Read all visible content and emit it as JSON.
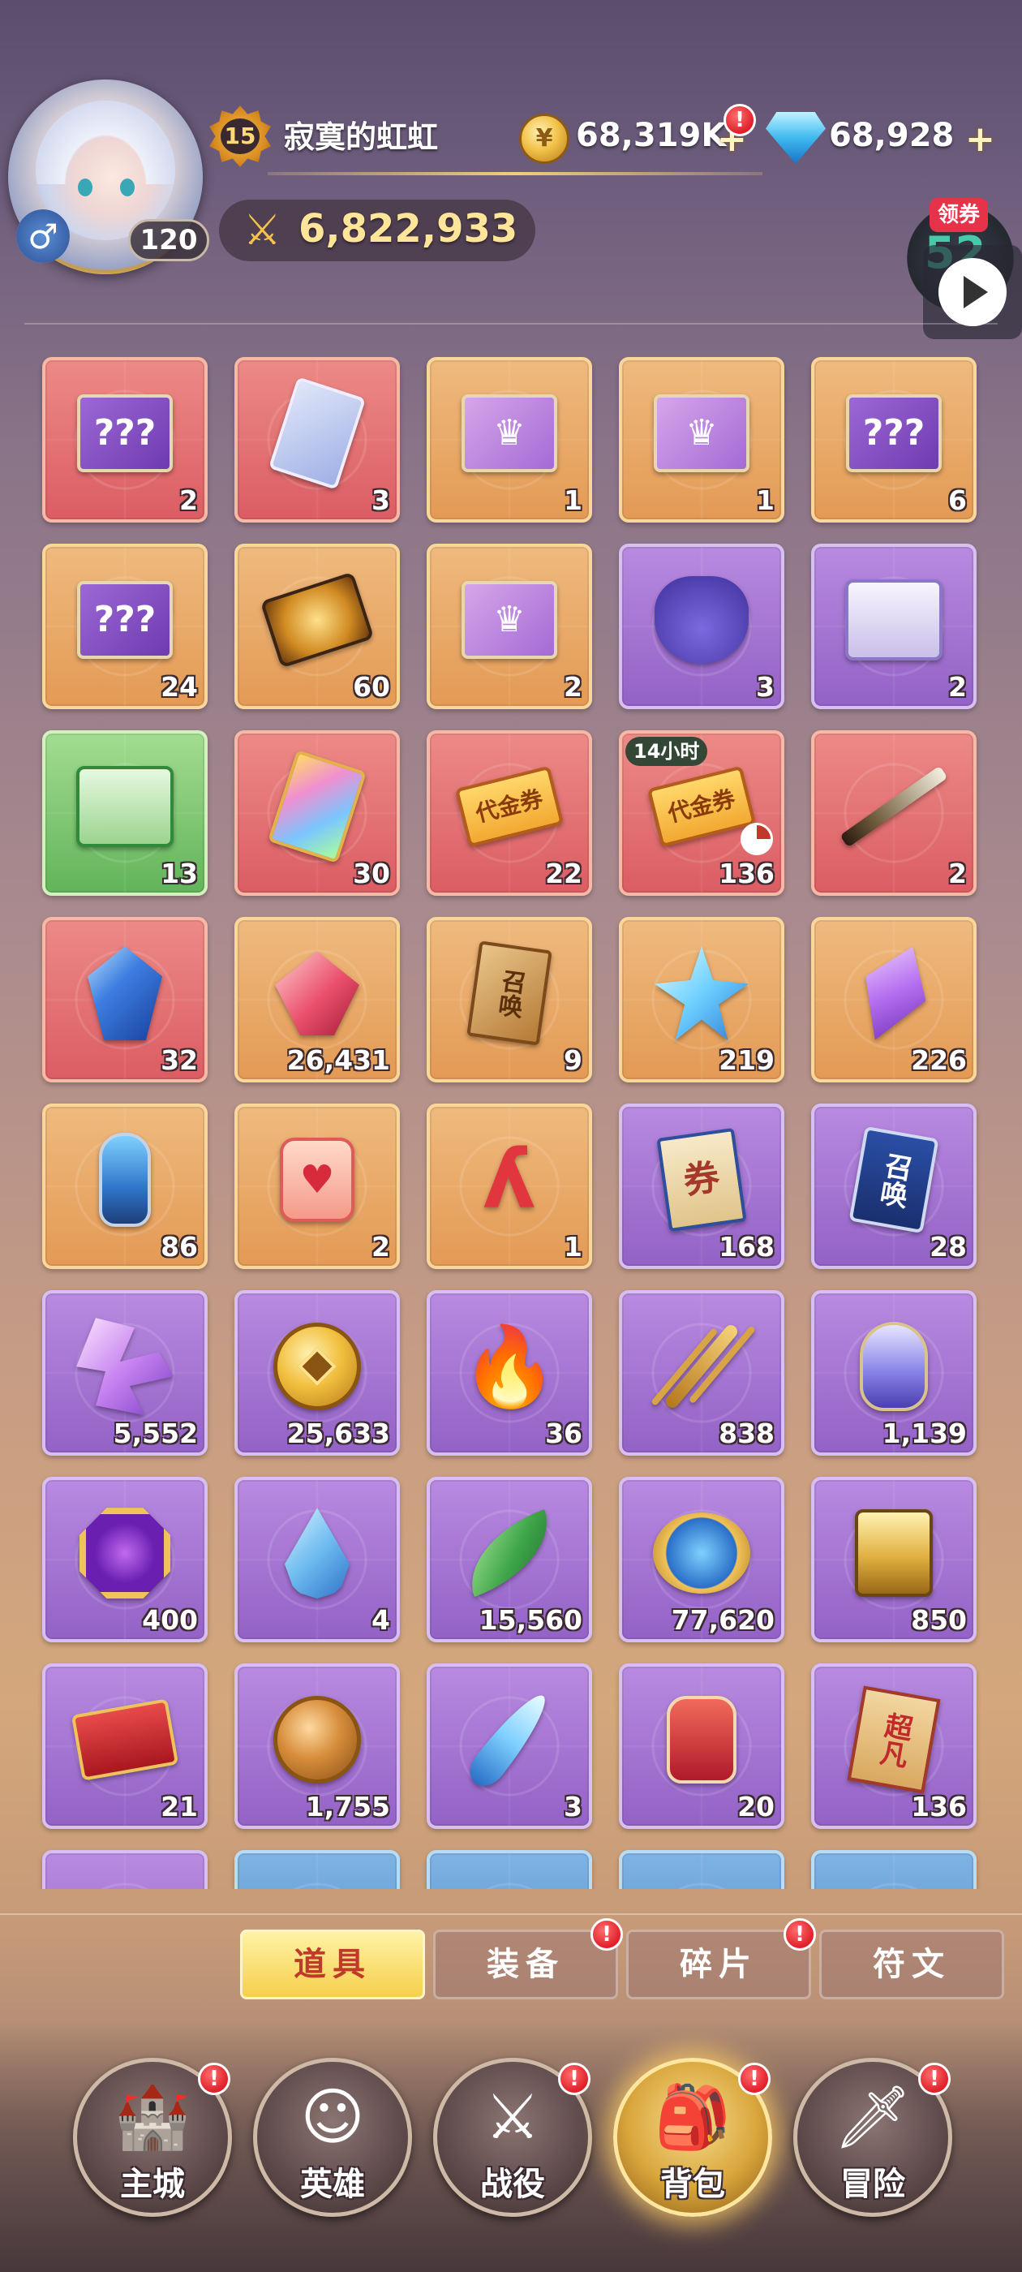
{
  "player": {
    "name": "寂寞的虹虹",
    "vip_level": "15",
    "level": "120",
    "power": "6,822,933",
    "gender_icon": "male-icon"
  },
  "resources": {
    "gold": "68,319K",
    "gems": "68,928"
  },
  "side": {
    "coupon_label": "领券",
    "coupon_value": "52"
  },
  "items": [
    {
      "quality": "red",
      "icon": "mystery-card-box-icon",
      "count": "2"
    },
    {
      "quality": "red",
      "icon": "tarot-card-icon",
      "count": "3"
    },
    {
      "quality": "orange",
      "icon": "hero-card-box-icon",
      "count": "1"
    },
    {
      "quality": "orange",
      "icon": "hero-card-box-icon",
      "count": "1"
    },
    {
      "quality": "orange",
      "icon": "mystery-card-box-icon",
      "count": "6"
    },
    {
      "quality": "orange",
      "icon": "mystery-card-box-icon",
      "count": "24"
    },
    {
      "quality": "orange",
      "icon": "gold-card-icon",
      "count": "60"
    },
    {
      "quality": "orange",
      "icon": "hero-card-box-icon",
      "count": "2"
    },
    {
      "quality": "purple",
      "icon": "loot-bag-icon",
      "count": "3"
    },
    {
      "quality": "purple",
      "icon": "purple-chest-icon",
      "count": "2"
    },
    {
      "quality": "green",
      "icon": "green-chest-icon",
      "count": "13"
    },
    {
      "quality": "red",
      "icon": "prism-card-icon",
      "count": "30"
    },
    {
      "quality": "red",
      "icon": "voucher-icon",
      "label": "代金券",
      "count": "22"
    },
    {
      "quality": "red",
      "icon": "voucher-icon",
      "label": "代金券",
      "count": "136",
      "timer": "14小时"
    },
    {
      "quality": "red",
      "icon": "sword-icon",
      "count": "2"
    },
    {
      "quality": "red",
      "icon": "blue-gem-icon",
      "count": "32"
    },
    {
      "quality": "orange",
      "icon": "red-crystal-icon",
      "count": "26,431"
    },
    {
      "quality": "orange",
      "icon": "summon-scroll-icon",
      "label": "召唤",
      "count": "9"
    },
    {
      "quality": "orange",
      "icon": "star-crystal-icon",
      "count": "219"
    },
    {
      "quality": "orange",
      "icon": "purple-shard-icon",
      "count": "226"
    },
    {
      "quality": "orange",
      "icon": "blue-bottle-icon",
      "count": "86"
    },
    {
      "quality": "orange",
      "icon": "honey-jar-icon",
      "count": "2"
    },
    {
      "quality": "orange",
      "icon": "red-rune-icon",
      "count": "1"
    },
    {
      "quality": "purple",
      "icon": "ticket-book-icon",
      "label": "券",
      "count": "168"
    },
    {
      "quality": "purple",
      "icon": "summon-card-icon",
      "label": "召唤",
      "count": "28"
    },
    {
      "quality": "purple",
      "icon": "crystal-shards-icon",
      "count": "5,552"
    },
    {
      "quality": "purple",
      "icon": "gold-coin-icon",
      "count": "25,633"
    },
    {
      "quality": "purple",
      "icon": "campfire-icon",
      "count": "36"
    },
    {
      "quality": "purple",
      "icon": "golden-branch-icon",
      "count": "838"
    },
    {
      "quality": "purple",
      "icon": "potion-icon",
      "count": "1,139"
    },
    {
      "quality": "purple",
      "icon": "octagon-gem-icon",
      "count": "400"
    },
    {
      "quality": "purple",
      "icon": "water-drop-icon",
      "count": "4"
    },
    {
      "quality": "purple",
      "icon": "leaf-icon",
      "count": "15,560"
    },
    {
      "quality": "purple",
      "icon": "blue-medal-icon",
      "count": "77,620"
    },
    {
      "quality": "purple",
      "icon": "gold-box-icon",
      "count": "850"
    },
    {
      "quality": "purple",
      "icon": "red-ticket-icon",
      "count": "21"
    },
    {
      "quality": "purple",
      "icon": "bronze-coin-icon",
      "count": "1,755"
    },
    {
      "quality": "purple",
      "icon": "feather-icon",
      "count": "3"
    },
    {
      "quality": "purple",
      "icon": "red-jar-icon",
      "count": "20"
    },
    {
      "quality": "purple",
      "icon": "red-scroll-icon",
      "label": "超凡",
      "count": "136"
    },
    {
      "quality": "purple",
      "icon": "",
      "count": ""
    },
    {
      "quality": "blue",
      "icon": "",
      "count": ""
    },
    {
      "quality": "blue",
      "icon": "",
      "count": ""
    },
    {
      "quality": "blue",
      "icon": "",
      "count": ""
    },
    {
      "quality": "blue",
      "icon": "",
      "count": ""
    }
  ],
  "tabs": [
    {
      "label": "道具",
      "active": true
    },
    {
      "label": "装备",
      "active": false,
      "alert": true
    },
    {
      "label": "碎片",
      "active": false,
      "alert": true
    },
    {
      "label": "符文",
      "active": false
    }
  ],
  "nav": [
    {
      "label": "主城",
      "icon": "castle-icon",
      "alert": true
    },
    {
      "label": "英雄",
      "icon": "hero-icon",
      "alert": false
    },
    {
      "label": "战役",
      "icon": "battle-sword-icon",
      "alert": true
    },
    {
      "label": "背包",
      "icon": "backpack-icon",
      "alert": true,
      "active": true
    },
    {
      "label": "冒险",
      "icon": "adventure-icon",
      "alert": true
    }
  ],
  "colors": {
    "red_quality": "#db5d63",
    "orange_quality": "#e39a55",
    "purple_quality": "#9362c6",
    "green_quality": "#62b45b",
    "active_tab": "#f6cf4c",
    "alert": "#e01f2a"
  }
}
